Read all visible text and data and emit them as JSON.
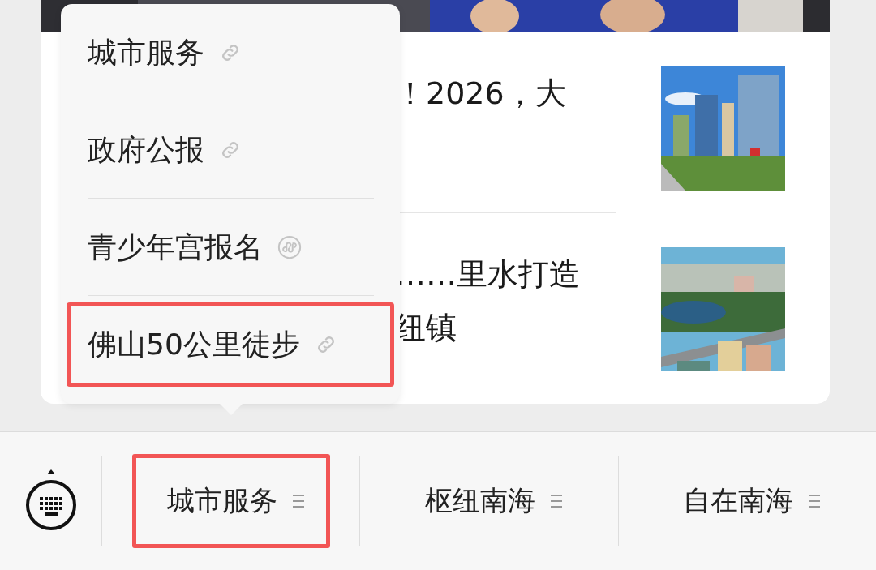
{
  "top_photo": {
    "kind": "picture"
  },
  "articles": [
    {
      "title_lines": [
        "！2026，大"
      ],
      "image": {
        "kind": "picture"
      }
    },
    {
      "title_lines": [
        "……里水打造",
        "纽镇"
      ],
      "image": {
        "kind": "picture"
      }
    }
  ],
  "popup_menu": {
    "items": [
      {
        "label": "城市服务",
        "kind": "link",
        "highlighted": false
      },
      {
        "label": "政府公报",
        "kind": "link",
        "highlighted": false
      },
      {
        "label": "青少年宫报名",
        "kind": "miniprogram",
        "highlighted": false
      },
      {
        "label": "佛山50公里徒步",
        "kind": "link",
        "highlighted": true
      }
    ]
  },
  "bottom_menu": {
    "items": [
      {
        "label": "城市服务",
        "highlighted": true
      },
      {
        "label": "枢纽南海",
        "highlighted": false
      },
      {
        "label": "自在南海",
        "highlighted": false
      }
    ]
  }
}
